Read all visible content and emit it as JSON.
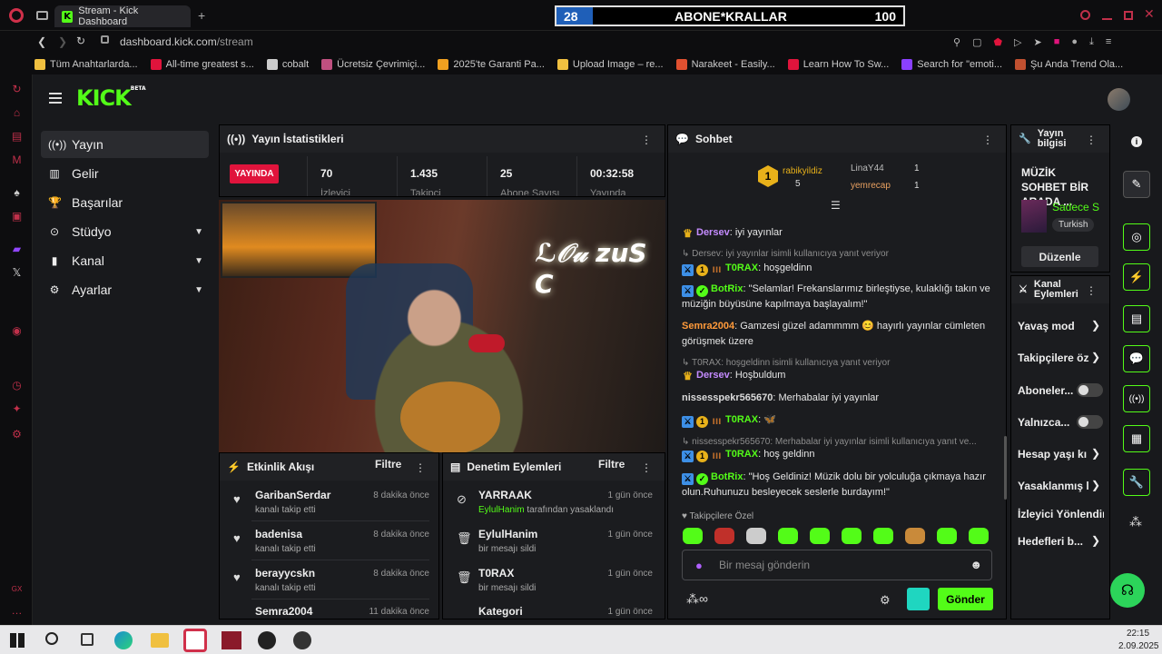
{
  "browser": {
    "tab_title": "Stream - Kick Dashboard",
    "new_tab": "+",
    "url_host": "dashboard.kick.com",
    "url_path": "/stream",
    "bookmarks": [
      "Tüm Anahtarlarda...",
      "All-time greatest s...",
      "cobalt",
      "Ücretsiz Çevrimiçi...",
      "2025'te Garanti Pa...",
      "Upload Image – re...",
      "Narakeet - Easily...",
      "Learn How To Sw...",
      "Search for \"emoti...",
      "Şu Anda Trend Ola..."
    ]
  },
  "goal_overlay": {
    "current": "28",
    "title": "ABONE*KRALLAR",
    "target": "100",
    "progress": 0.28,
    "fill_color": "#1f5fb8"
  },
  "kick": {
    "logo": "KICK",
    "logo_tag": "BETA",
    "brand_color": "#53fc18",
    "nav": [
      {
        "label": "Yayın",
        "icon": "broadcast-icon"
      },
      {
        "label": "Gelir",
        "icon": "revenue-icon"
      },
      {
        "label": "Başarılar",
        "icon": "trophy-icon"
      },
      {
        "label": "Stüdyo",
        "icon": "studio-icon"
      },
      {
        "label": "Kanal",
        "icon": "channel-icon"
      },
      {
        "label": "Ayarlar",
        "icon": "settings-icon"
      }
    ]
  },
  "stats": {
    "title": "Yayın İstatistikleri",
    "live": "YAYINDA",
    "items": [
      {
        "value": "70",
        "label": "İzleyici"
      },
      {
        "value": "1.435",
        "label": "Takipçi"
      },
      {
        "value": "25",
        "label": "Abone Sayısı"
      },
      {
        "value": "00:32:58",
        "label": "Yayında"
      }
    ]
  },
  "activity": {
    "title": "Etkinlik Akışı",
    "filter": "Filtre",
    "items": [
      {
        "name": "GaribanSerdar",
        "sub": "kanalı takip etti",
        "time": "8 dakika önce"
      },
      {
        "name": "badenisa",
        "sub": "kanalı takip etti",
        "time": "8 dakika önce"
      },
      {
        "name": "berayycskn",
        "sub": "kanalı takip etti",
        "time": "8 dakika önce"
      },
      {
        "name": "Semra2004",
        "sub": "",
        "time": "11 dakika önce"
      }
    ]
  },
  "moderation": {
    "title": "Denetim Eylemleri",
    "filter": "Filtre",
    "items": [
      {
        "name": "YARRAAK",
        "sub_user": "EylulHanim",
        "sub": "tarafından yasaklandı",
        "time": "1 gün önce"
      },
      {
        "name": "EylulHanim",
        "sub": "bir mesajı sildi",
        "time": "1 gün önce"
      },
      {
        "name": "T0RAX",
        "sub": "bir mesajı sildi",
        "time": "1 gün önce"
      },
      {
        "name": "Kategori",
        "sub": "",
        "time": "1 gün önce"
      }
    ]
  },
  "chat": {
    "title": "Sohbet",
    "top_gifters": [
      {
        "rank": "1",
        "name": "rabikyildiz",
        "count": "5"
      },
      {
        "name": "LinaY44",
        "count": "1"
      },
      {
        "name": "yemrecap",
        "count": "1"
      }
    ],
    "messages": [
      {
        "user": "Dersev",
        "text": "iyi yayınlar"
      },
      {
        "reply": "Dersev: iyi yayınlar isimli kullanıcıya yanıt veriyor"
      },
      {
        "user": "T0RAX",
        "text": "hoşgeldinn"
      },
      {
        "user": "BotRix",
        "text": "\"Selamlar! Frekanslarımız birleştiyse, kulaklığı takın ve müziğin büyüsüne kapılmaya başlayalım!\""
      },
      {
        "user": "Semra2004",
        "text": "Gamzesi güzel adammmm 😊 hayırlı yayınlar cümleten görüşmek üzere"
      },
      {
        "reply": "T0RAX: hoşgeldinn isimli kullanıcıya yanıt veriyor"
      },
      {
        "user": "Dersev",
        "text": "Hoşbuldum"
      },
      {
        "user": "nissesspekr565670",
        "text": "Merhabalar iyi yayınlar"
      },
      {
        "user": "T0RAX",
        "text": "🦋"
      },
      {
        "reply": "nissesspekr565670: Merhabalar iyi yayınlar isimli kullanıcıya yanıt ve..."
      },
      {
        "user": "T0RAX",
        "text": "hoş geldinn"
      },
      {
        "user": "BotRix",
        "text": "\"Hoş Geldiniz! Müzik dolu bir yolculuğa çıkmaya hazır olun.Ruhunuzu besleyecek seslerle burdayım!\""
      }
    ],
    "followers_only": "Takipçilere Özel",
    "placeholder": "Bir mesaj gönderin",
    "send": "Gönder"
  },
  "stream_info": {
    "title": "Yayın bilgisi",
    "stream_title": "MÜZİK SOHBET BİR ARADA ...",
    "category": "Sadece S",
    "language": "Turkish",
    "edit": "Düzenle"
  },
  "channel_actions": {
    "title": "Kanal Eylemleri",
    "items": [
      "Yavaş mod",
      "Takipçilere öz",
      "Aboneler...",
      "Yalnızca...",
      "Hesap yaşı kı",
      "Yasaklanmış l",
      "İzleyici Yönlendir",
      "Hedefleri b..."
    ]
  },
  "taskbar": {
    "time": "22:15",
    "date": "2.09.2025"
  }
}
